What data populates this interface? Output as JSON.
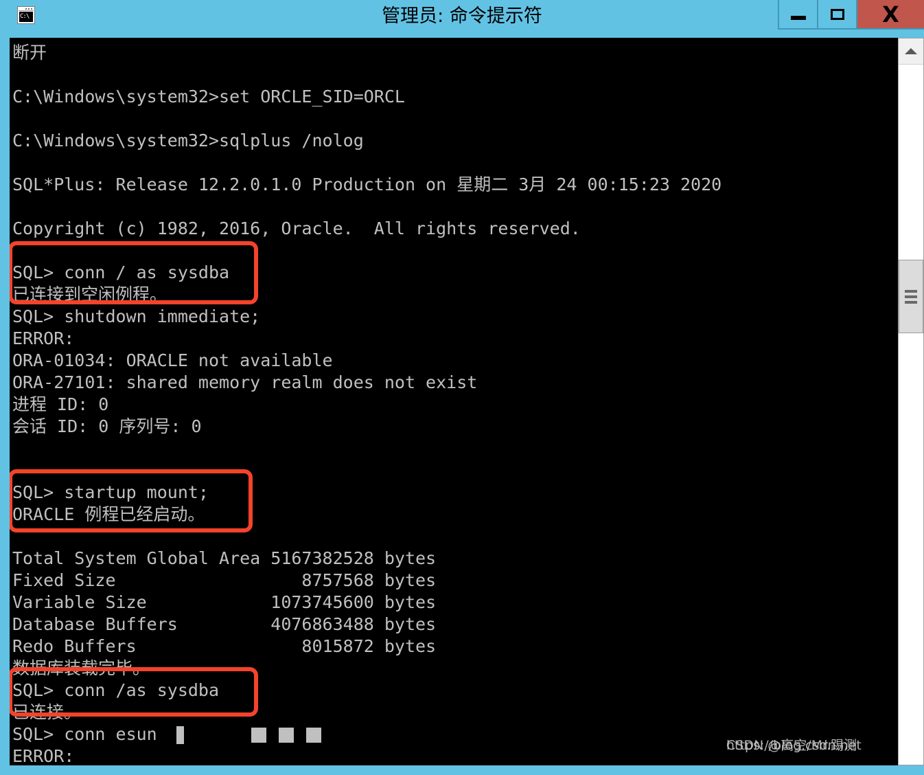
{
  "window": {
    "title": "管理员: 命令提示符",
    "icon_name": "cmd-console-icon",
    "icon_text": "C:\\",
    "accent_color": "#62c2e4",
    "close_color": "#c0564c",
    "controls": {
      "minimize_label": "—",
      "maximize_label": "□",
      "close_label": "X"
    }
  },
  "console": {
    "background": "#000000",
    "text_color": "#c0c0c0",
    "lines": [
      "断开",
      "",
      "C:\\Windows\\system32>set ORCLE_SID=ORCL",
      "",
      "C:\\Windows\\system32>sqlplus /nolog",
      "",
      "SQL*Plus: Release 12.2.0.1.0 Production on 星期二 3月 24 00:15:23 2020",
      "",
      "Copyright (c) 1982, 2016, Oracle.  All rights reserved.",
      "",
      "SQL> conn / as sysdba",
      "已连接到空闲例程。",
      "SQL> shutdown immediate;",
      "ERROR:",
      "ORA-01034: ORACLE not available",
      "ORA-27101: shared memory realm does not exist",
      "进程 ID: 0",
      "会话 ID: 0 序列号: 0",
      "",
      "",
      "SQL> startup mount;",
      "ORACLE 例程已经启动。",
      "",
      "Total System Global Area 5167382528 bytes",
      "Fixed Size                  8757568 bytes",
      "Variable Size            1073745600 bytes",
      "Database Buffers         4076863488 bytes",
      "Redo Buffers                8015872 bytes",
      "数据库装载完毕。",
      "SQL> conn /as sysdba",
      "已连接。",
      "SQL> conn esun",
      "ERROR:"
    ]
  },
  "annotations": {
    "box_color": "#f4432b",
    "boxes": [
      {
        "name": "conn-as-sysdba-idle",
        "note": "SQL> conn / as sysdba / 已连接到空闲例程。"
      },
      {
        "name": "startup-mount",
        "note": "SQL> startup mount; / ORACLE 例程已经启动。"
      },
      {
        "name": "conn-as-sysdba-connected",
        "note": "SQL> conn /as sysdba / 已连接。"
      }
    ]
  },
  "scrollbar": {
    "up_arrow": "▲",
    "thumb_grip": "≡"
  },
  "watermark": {
    "url": "https://blog.csdn.net",
    "author": "CSDN @高空/Mr.踢测"
  }
}
